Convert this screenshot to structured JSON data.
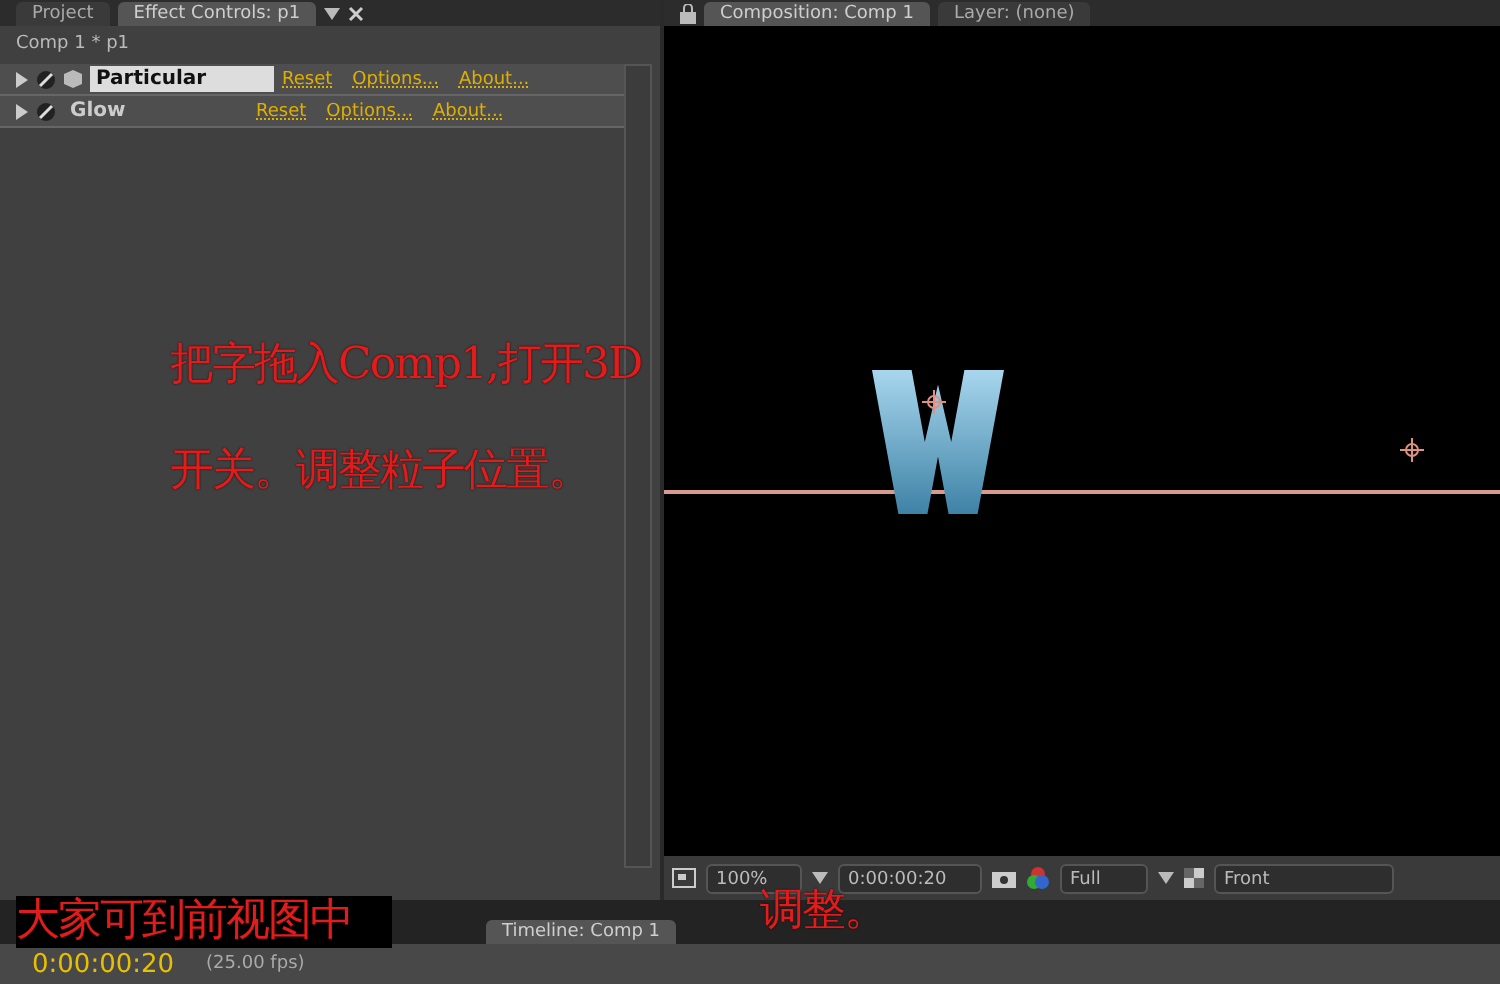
{
  "left_panel": {
    "tabs": [
      {
        "label": "Project",
        "selected": false
      },
      {
        "label": "Effect Controls: p1",
        "selected": true
      }
    ],
    "subtitle": "Comp 1 * p1",
    "effects": [
      {
        "name": "Particular",
        "selected": true,
        "links": [
          "Reset",
          "Options...",
          "About..."
        ]
      },
      {
        "name": "Glow",
        "selected": false,
        "links": [
          "Reset",
          "Options...",
          "About..."
        ]
      }
    ]
  },
  "composition_panel": {
    "tabs": [
      {
        "label": "Composition: Comp 1",
        "selected": true
      },
      {
        "label": "Layer: (none)",
        "selected": false
      }
    ],
    "toolbar": {
      "zoom": "100%",
      "timecode": "0:00:00:20",
      "resolution": "Full",
      "view": "Front"
    }
  },
  "timeline": {
    "tab": "Timeline: Comp 1",
    "timecode": "0:00:00:20",
    "fps": "(25.00 fps)"
  },
  "annotations": [
    {
      "text": "把字拖入Comp1,打开3D"
    },
    {
      "text": "开关。调整粒子位置。"
    },
    {
      "text": "大家可到前视图中"
    },
    {
      "text": "调整。"
    }
  ]
}
